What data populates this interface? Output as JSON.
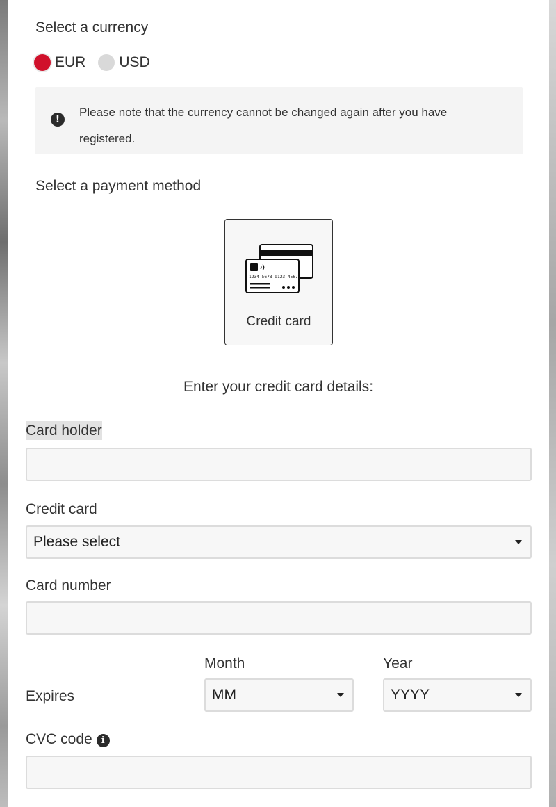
{
  "currency": {
    "title": "Select a currency",
    "options": [
      {
        "label": "EUR",
        "selected": true
      },
      {
        "label": "USD",
        "selected": false
      }
    ],
    "notice": "Please note that the currency cannot be changed again after you have registered.",
    "selected_color": "#d0112b"
  },
  "payment": {
    "title": "Select a payment method",
    "methods": [
      {
        "label": "Credit card",
        "icon": "credit-card-icon",
        "card_number_text": "1234 5678 9123 4567"
      }
    ]
  },
  "form": {
    "intro": "Enter your credit card details:",
    "card_holder": {
      "label": "Card holder",
      "value": ""
    },
    "credit_card": {
      "label": "Credit card",
      "value": "Please select"
    },
    "card_number": {
      "label": "Card number",
      "value": ""
    },
    "expires": {
      "label": "Expires",
      "month_label": "Month",
      "month_value": "MM",
      "year_label": "Year",
      "year_value": "YYYY"
    },
    "cvc": {
      "label": "CVC code",
      "value": "",
      "icon": "info-icon"
    }
  }
}
